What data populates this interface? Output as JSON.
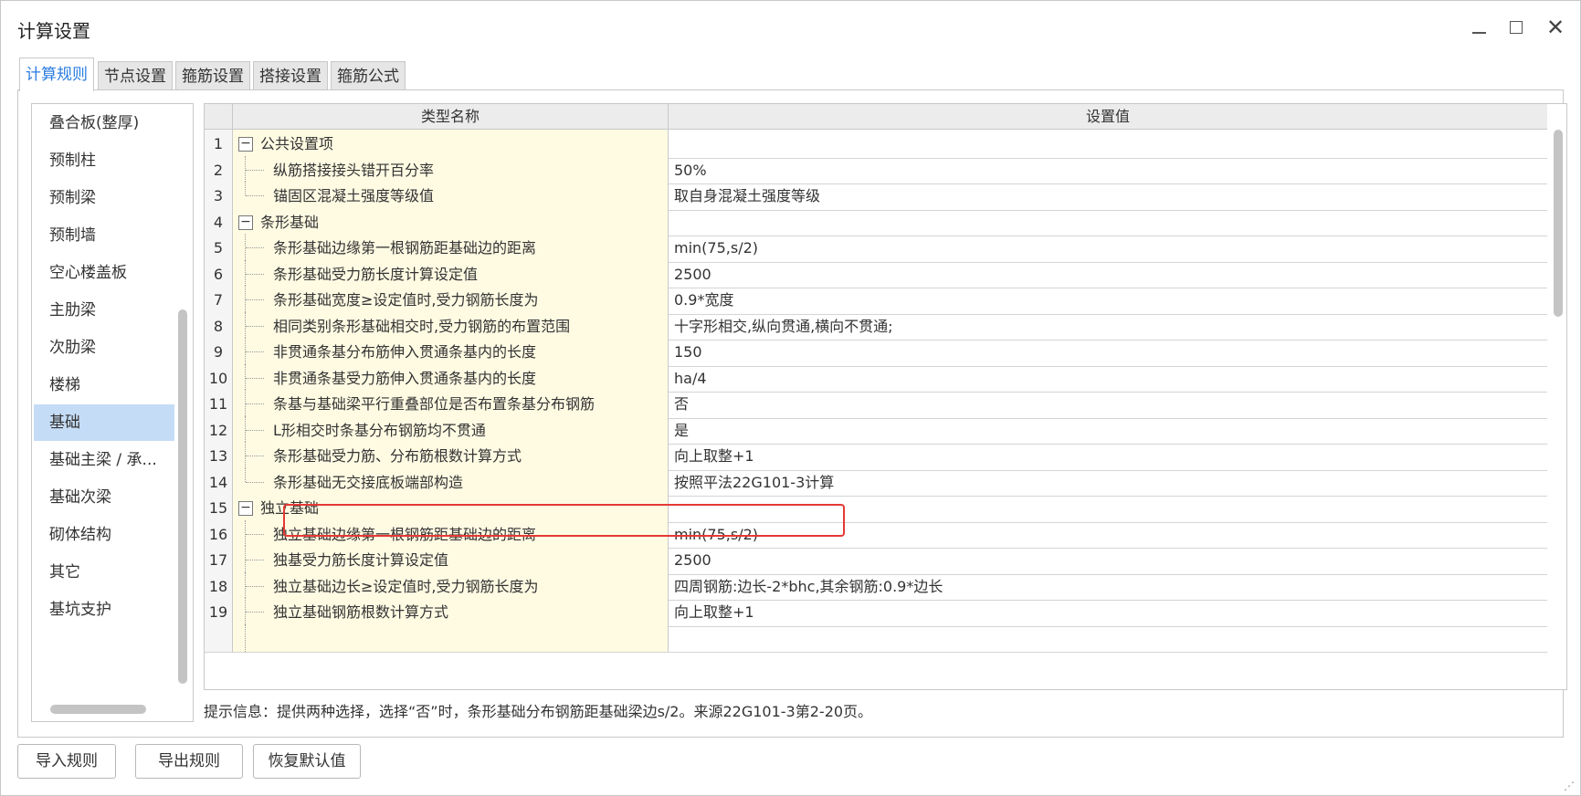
{
  "window": {
    "title": "计算设置"
  },
  "tabs": [
    {
      "label": "计算规则",
      "active": true
    },
    {
      "label": "节点设置",
      "active": false
    },
    {
      "label": "箍筋设置",
      "active": false
    },
    {
      "label": "搭接设置",
      "active": false
    },
    {
      "label": "箍筋公式",
      "active": false
    }
  ],
  "sidebar": {
    "items": [
      {
        "label": "叠合板(整厚)"
      },
      {
        "label": "预制柱"
      },
      {
        "label": "预制梁"
      },
      {
        "label": "预制墙"
      },
      {
        "label": "空心楼盖板"
      },
      {
        "label": "主肋梁"
      },
      {
        "label": "次肋梁"
      },
      {
        "label": "楼梯"
      },
      {
        "label": "基础",
        "active": true
      },
      {
        "label": "基础主梁 / 承..."
      },
      {
        "label": "基础次梁"
      },
      {
        "label": "砌体结构"
      },
      {
        "label": "其它"
      },
      {
        "label": "基坑支护"
      }
    ]
  },
  "grid": {
    "headers": {
      "name": "类型名称",
      "value": "设置值"
    },
    "rows": [
      {
        "num": "1",
        "name": "公共设置项",
        "value": "",
        "group": true,
        "toggle": "−"
      },
      {
        "num": "2",
        "name": "纵筋搭接接头错开百分率",
        "value": "50%"
      },
      {
        "num": "3",
        "name": "锚固区混凝土强度等级值",
        "value": "取自身混凝土强度等级"
      },
      {
        "num": "4",
        "name": "条形基础",
        "value": "",
        "group": true,
        "toggle": "−"
      },
      {
        "num": "5",
        "name": "条形基础边缘第一根钢筋距基础边的距离",
        "value": "min(75,s/2)"
      },
      {
        "num": "6",
        "name": "条形基础受力筋长度计算设定值",
        "value": "2500"
      },
      {
        "num": "7",
        "name": "条形基础宽度≥设定值时,受力钢筋长度为",
        "value": "0.9*宽度"
      },
      {
        "num": "8",
        "name": "相同类别条形基础相交时,受力钢筋的布置范围",
        "value": "十字形相交,纵向贯通,横向不贯通;"
      },
      {
        "num": "9",
        "name": "非贯通条基分布筋伸入贯通条基内的长度",
        "value": "150"
      },
      {
        "num": "10",
        "name": "非贯通条基受力筋伸入贯通条基内的长度",
        "value": "ha/4"
      },
      {
        "num": "11",
        "name": "条基与基础梁平行重叠部位是否布置条基分布钢筋",
        "value": "否"
      },
      {
        "num": "12",
        "name": "L形相交时条基分布钢筋均不贯通",
        "value": "是"
      },
      {
        "num": "13",
        "name": "条形基础受力筋、分布筋根数计算方式",
        "value": "向上取整+1"
      },
      {
        "num": "14",
        "name": "条形基础无交接底板端部构造",
        "value": "按照平法22G101-3计算"
      },
      {
        "num": "15",
        "name": "独立基础",
        "value": "",
        "group": true,
        "toggle": "−"
      },
      {
        "num": "16",
        "name": "独立基础边缘第一根钢筋距基础边的距离",
        "value": "min(75,s/2)"
      },
      {
        "num": "17",
        "name": "独基受力筋长度计算设定值",
        "value": "2500"
      },
      {
        "num": "18",
        "name": "独立基础边长≥设定值时,受力钢筋长度为",
        "value": "四周钢筋:边长-2*bhc,其余钢筋:0.9*边长"
      },
      {
        "num": "19",
        "name": "独立基础钢筋根数计算方式",
        "value": "向上取整+1"
      }
    ]
  },
  "hint": "提示信息：提供两种选择，选择“否”时，条形基础分布钢筋距基础梁边s/2。来源22G101-3第2-20页。",
  "buttons": {
    "import": "导入规则",
    "export": "导出规则",
    "restore": "恢复默认值"
  },
  "icons": {
    "minimize": "minimize-icon",
    "maximize": "maximize-icon",
    "close": "close-icon"
  },
  "colors": {
    "accent": "#2a7de1",
    "selected": "#c5dcf6",
    "name_column": "#fffbe3",
    "highlight": "#e53935"
  }
}
